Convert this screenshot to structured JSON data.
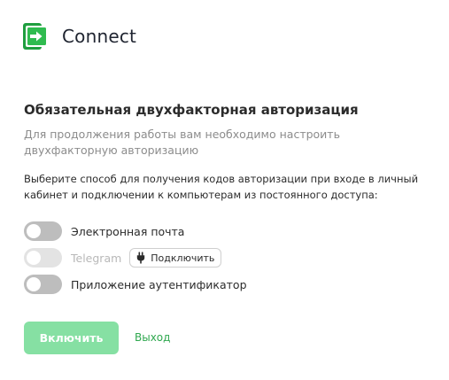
{
  "brand": {
    "name": "Connect",
    "icon": "connect-logo-icon",
    "color": "#2fbb4f"
  },
  "page": {
    "title": "Обязательная двухфакторная авторизация",
    "subtitle": "Для продолжения работы вам необходимо настроить двухфакторную авторизацию",
    "description": "Выберите способ для получения кодов авторизации при входе в личный кабинет и подключении к компьютерам из постоянного доступа:"
  },
  "options": [
    {
      "label": "Электронная почта",
      "enabled": false,
      "disabled": false
    },
    {
      "label": "Telegram",
      "enabled": false,
      "disabled": true,
      "button_label": "Подключить",
      "button_icon": "plug-icon"
    },
    {
      "label": "Приложение аутентификатор",
      "enabled": false,
      "disabled": false
    }
  ],
  "actions": {
    "enable_label": "Включить",
    "logout_label": "Выход",
    "enable_color": "#86e0a3",
    "link_color": "#2fa84f"
  }
}
